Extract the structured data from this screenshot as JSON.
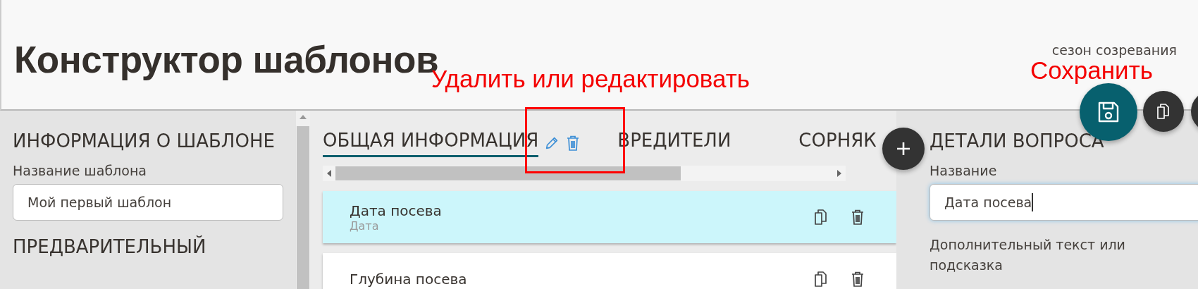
{
  "header": {
    "title": "Конструктор шаблонов",
    "subtitle": "сезон созревания"
  },
  "annotations": [
    {
      "kind": "label",
      "text": "Удалить или редактировать"
    },
    {
      "kind": "label",
      "text": "Сохранить"
    },
    {
      "kind": "box"
    }
  ],
  "template_info": {
    "heading": "ИНФОРМАЦИЯ О ШАБЛОНЕ",
    "name_label": "Название шаблона",
    "name_value": "Мой первый шаблон",
    "preview_heading": "ПРЕДВАРИТЕЛЬНЫЙ"
  },
  "tabs": [
    {
      "label": "ОБЩАЯ ИНФОРМАЦИЯ",
      "selected": true
    },
    {
      "label": "ВРЕДИТЕЛИ",
      "selected": false
    },
    {
      "label": "СОРНЯК",
      "selected": false
    }
  ],
  "questions": [
    {
      "title": "Дата посева",
      "type": "Дата",
      "selected": true
    },
    {
      "title": "Глубина посева",
      "selected": false
    }
  ],
  "question_details": {
    "heading": "ДЕТАЛИ ВОПРОСА",
    "name_label": "Название",
    "name_value": "Дата посева",
    "focused": true,
    "hint_label": "Дополнительный текст или подсказка"
  }
}
